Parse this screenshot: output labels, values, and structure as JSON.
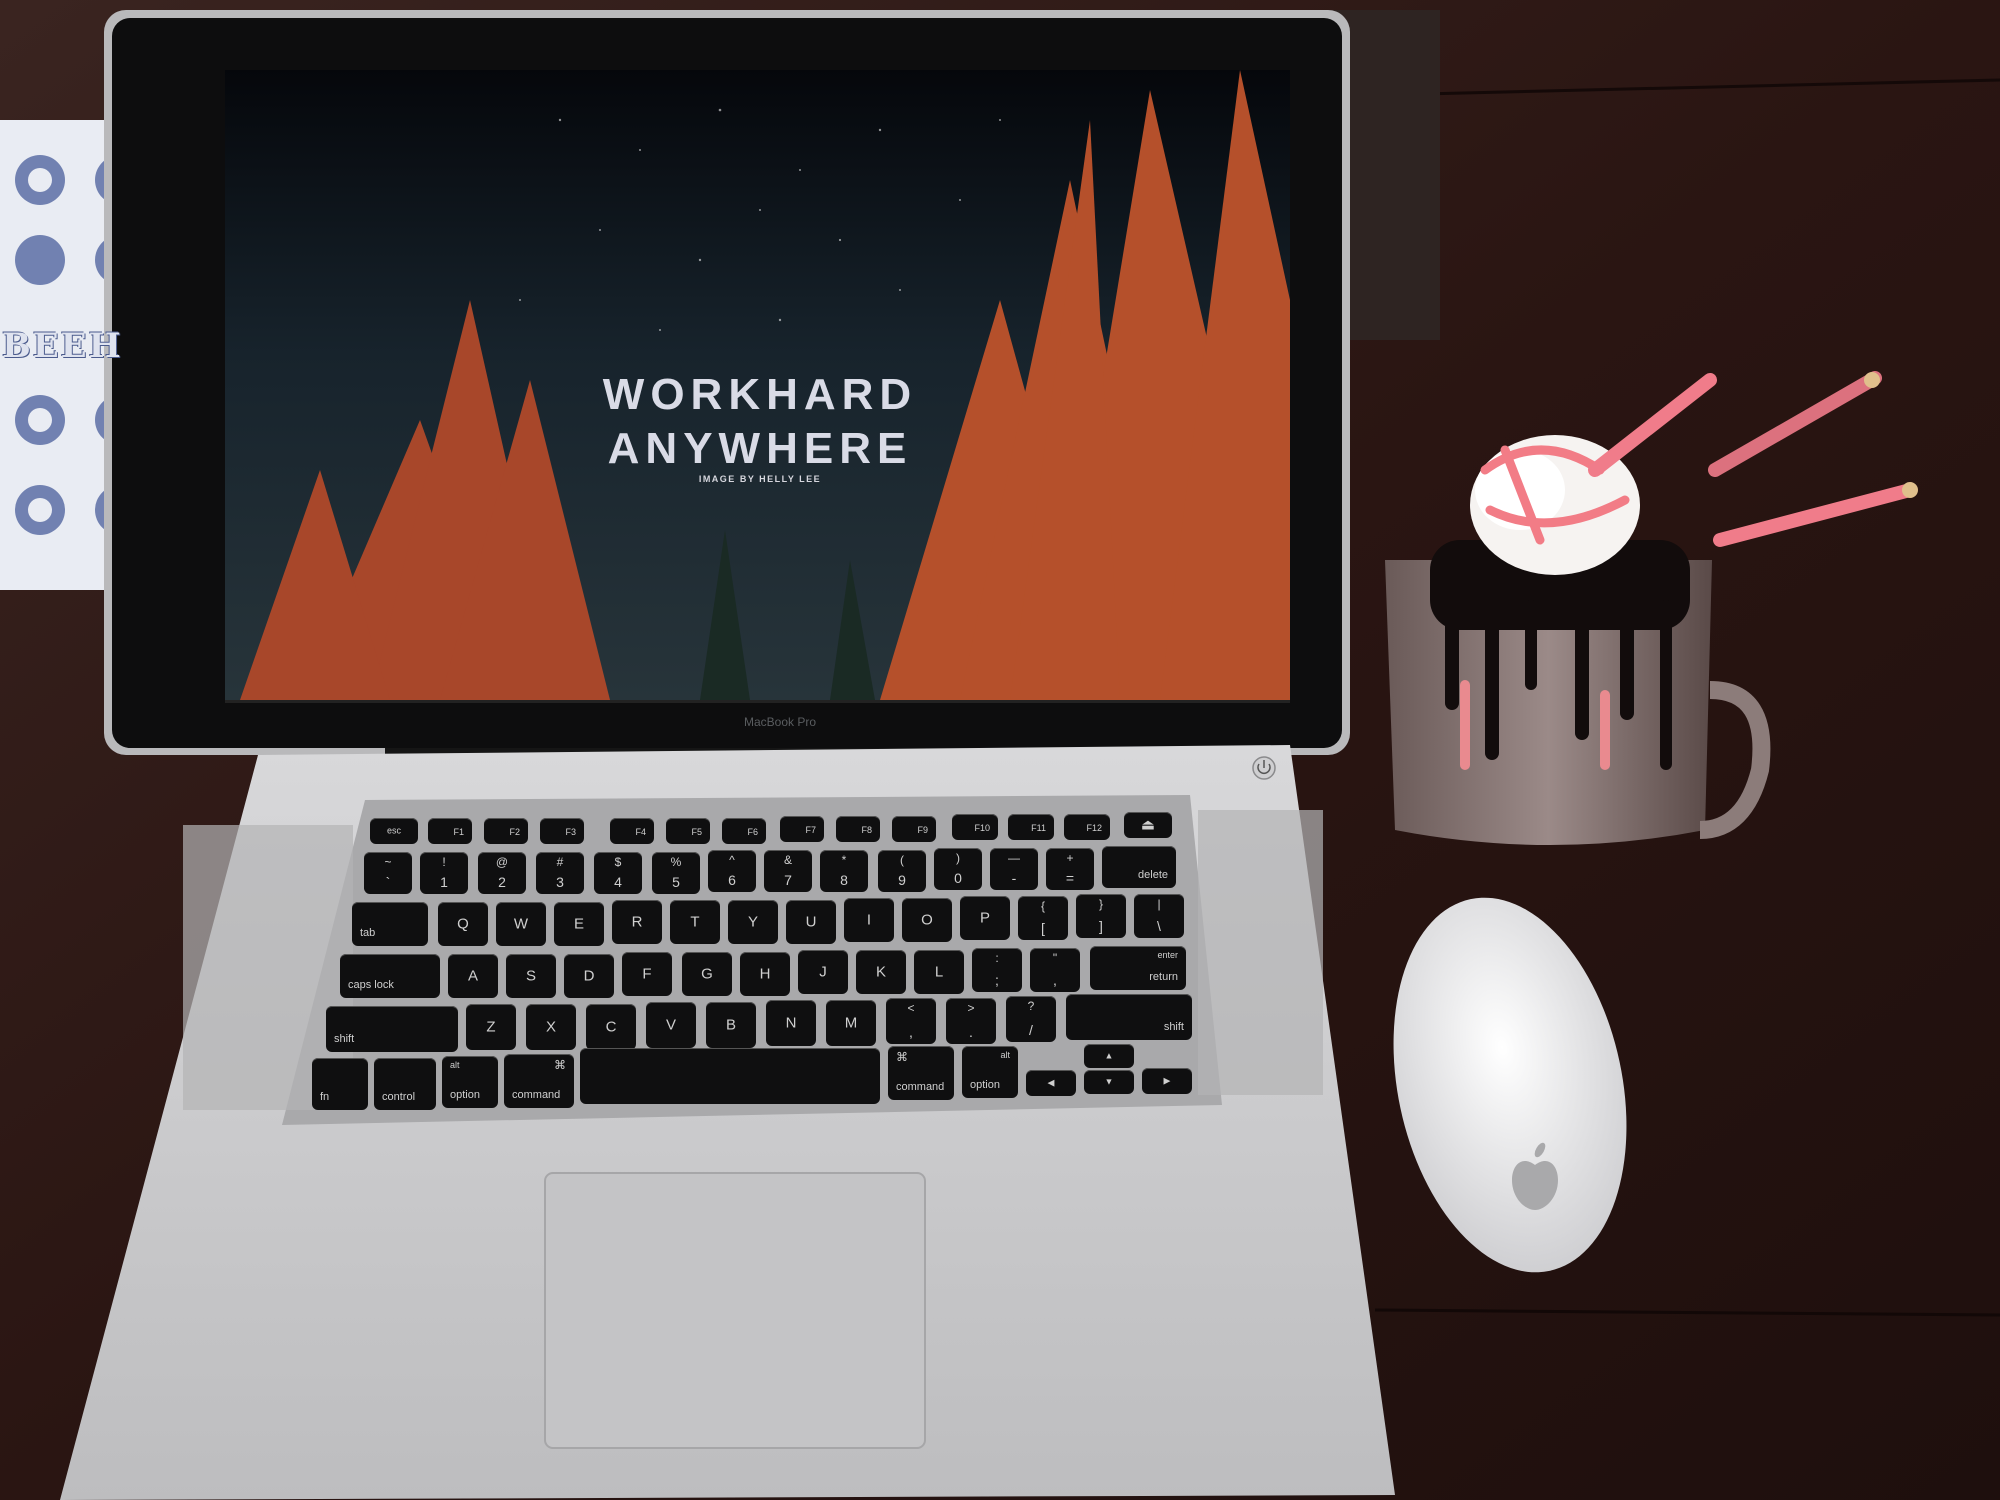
{
  "screen": {
    "headline": "WORKHARD\nANYWHERE",
    "credit": "IMAGE BY HELLY LEE"
  },
  "laptop": {
    "brand_label": "MacBook Pro"
  },
  "menu": {
    "visible_text": "BEEH"
  },
  "keyboard": {
    "fn_row": [
      "esc",
      "F1",
      "F2",
      "F3",
      "F4",
      "F5",
      "F6",
      "F7",
      "F8",
      "F9",
      "F10",
      "F11",
      "F12",
      ""
    ],
    "number_row": [
      {
        "top": "~",
        "bottom": "`"
      },
      {
        "top": "!",
        "bottom": "1"
      },
      {
        "top": "@",
        "bottom": "2"
      },
      {
        "top": "#",
        "bottom": "3"
      },
      {
        "top": "$",
        "bottom": "4"
      },
      {
        "top": "%",
        "bottom": "5"
      },
      {
        "top": "^",
        "bottom": "6"
      },
      {
        "top": "&",
        "bottom": "7"
      },
      {
        "top": "*",
        "bottom": "8"
      },
      {
        "top": "(",
        "bottom": "9"
      },
      {
        "top": ")",
        "bottom": "0"
      },
      {
        "top": "—",
        "bottom": "-"
      },
      {
        "top": "+",
        "bottom": "="
      }
    ],
    "delete": "delete",
    "tab": "tab",
    "qwerty_row": [
      "Q",
      "W",
      "E",
      "R",
      "T",
      "Y",
      "U",
      "I",
      "O",
      "P"
    ],
    "bracket_keys": [
      {
        "top": "{",
        "bottom": "["
      },
      {
        "top": "}",
        "bottom": "]"
      },
      {
        "top": "|",
        "bottom": "\\"
      }
    ],
    "caps_lock": "caps lock",
    "home_row": [
      "A",
      "S",
      "D",
      "F",
      "G",
      "H",
      "J",
      "K",
      "L"
    ],
    "home_punct": [
      {
        "top": ":",
        "bottom": ";"
      },
      {
        "top": "\"",
        "bottom": ","
      }
    ],
    "enter_top": "enter",
    "return": "return",
    "shift_left": "shift",
    "bottom_letters": [
      "Z",
      "X",
      "C",
      "V",
      "B",
      "N",
      "M"
    ],
    "bottom_punct": [
      {
        "top": "<",
        "bottom": ","
      },
      {
        "top": ">",
        "bottom": "."
      },
      {
        "top": "?",
        "bottom": "/"
      }
    ],
    "shift_right": "shift",
    "fn": "fn",
    "control": "control",
    "option_left": "option",
    "alt_left": "alt",
    "command_left": "command",
    "command_symbol": "⌘",
    "command_right": "command",
    "option_right": "option",
    "alt_right": "alt",
    "arrows": [
      "◀",
      "▲",
      "▼",
      "▶"
    ]
  },
  "colors": {
    "table": "#2b1613",
    "aluminum": "#c9c9cb",
    "sky": "#1a2630",
    "trees": "#b5502b",
    "keycap": "#0f0f10"
  },
  "icons": [
    "power-icon",
    "apple-logo-icon"
  ]
}
